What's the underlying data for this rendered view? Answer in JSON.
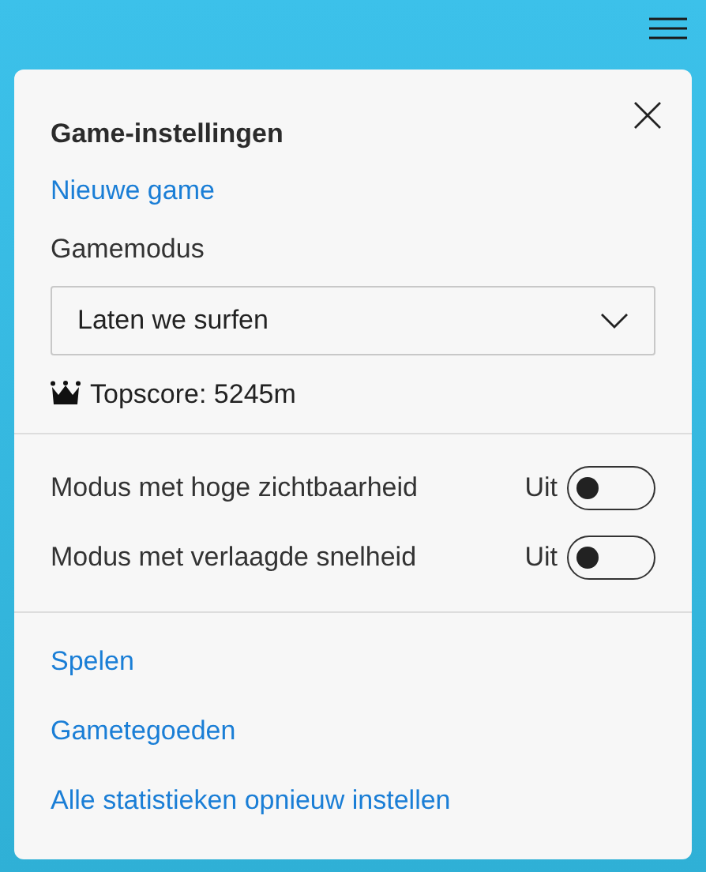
{
  "panel": {
    "title": "Game-instellingen",
    "new_game_link": "Nieuwe game",
    "mode_label": "Gamemodus",
    "mode_value": "Laten we surfen",
    "high_score": "Topscore: 5245m"
  },
  "toggles": [
    {
      "label": "Modus met hoge zichtbaarheid",
      "state_text": "Uit",
      "on": false
    },
    {
      "label": "Modus met verlaagde snelheid",
      "state_text": "Uit",
      "on": false
    }
  ],
  "links": [
    "Spelen",
    "Gametegoeden",
    "Alle statistieken opnieuw instellen"
  ]
}
